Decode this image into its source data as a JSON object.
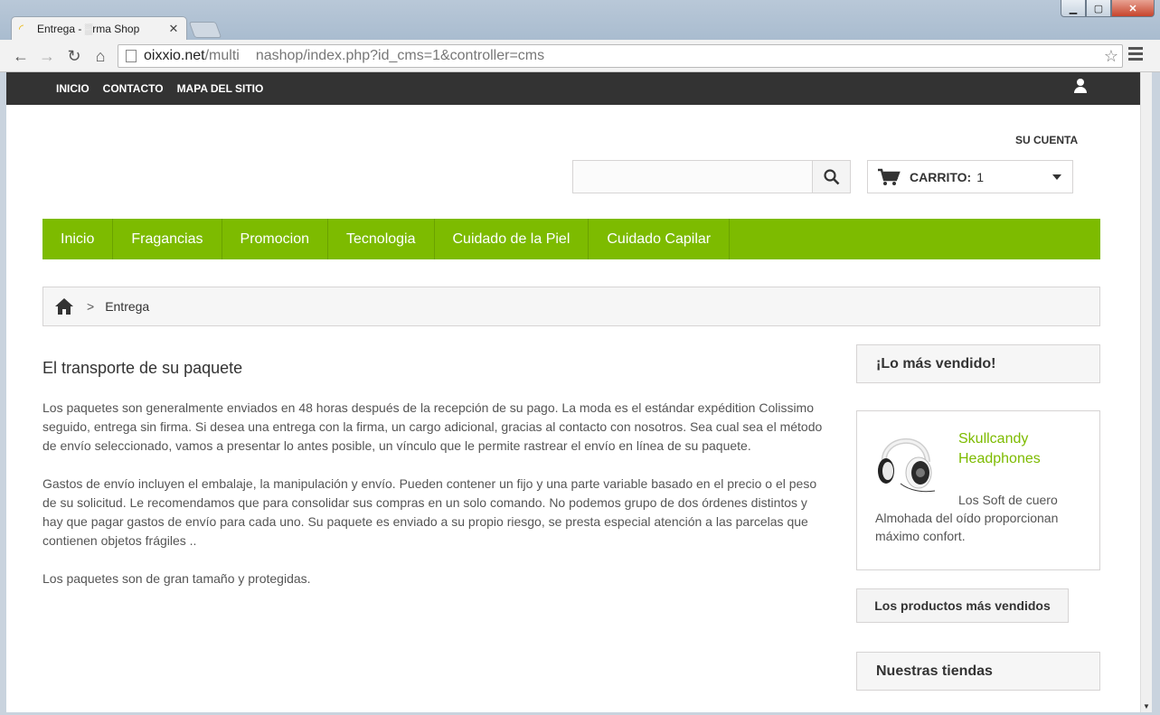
{
  "browser": {
    "tab_title": "Entrega - ",
    "tab_title_tail": "rma Shop",
    "url_domain": "oixxio.net",
    "url_path": "/multi",
    "url_rest": "nashop/index.php?id_cms=1&controller=cms"
  },
  "topnav": {
    "items": [
      "INICIO",
      "CONTACTO",
      "MAPA DEL SITIO"
    ]
  },
  "header": {
    "account_label": "SU CUENTA",
    "search_placeholder": "",
    "cart_label": "CARRITO:",
    "cart_count": "1"
  },
  "menu": {
    "items": [
      "Inicio",
      "Fragancias",
      "Promocion",
      "Tecnologia",
      "Cuidado de la Piel",
      "Cuidado Capilar"
    ]
  },
  "breadcrumb": {
    "separator": ">",
    "current": "Entrega"
  },
  "content": {
    "title": "El transporte de su paquete",
    "paragraphs": [
      "Los paquetes son generalmente enviados en 48 horas después de la recepción de su pago. La moda es el estándar expédition Colissimo seguido, entrega sin firma. Si desea una entrega con la firma, un cargo adicional, gracias al contacto con nosotros. Sea cual sea el método de envío seleccionado, vamos a presentar lo antes posible, un vínculo que le permite rastrear el envío en línea de su paquete.",
      "Gastos de envío incluyen el embalaje, la manipulación y envío. Pueden contener un fijo y una parte variable basado en el precio o el peso de su solicitud. Le recomendamos que para consolidar sus compras en un solo comando. No podemos grupo de dos órdenes distintos y hay que pagar gastos de envío para cada uno. Su paquete es enviado a su propio riesgo, se presta especial atención a las parcelas que contienen objetos frágiles ..",
      "Los paquetes son de gran tamaño y protegidas."
    ]
  },
  "sidebar": {
    "bestsellers_title": "¡Lo más vendido!",
    "product_name": "Skullcandy Headphones",
    "product_desc": "Los Soft de cuero Almohada del oído proporcionan máximo confort.",
    "bestsellers_button": "Los productos más vendidos",
    "stores_title": "Nuestras tiendas"
  }
}
